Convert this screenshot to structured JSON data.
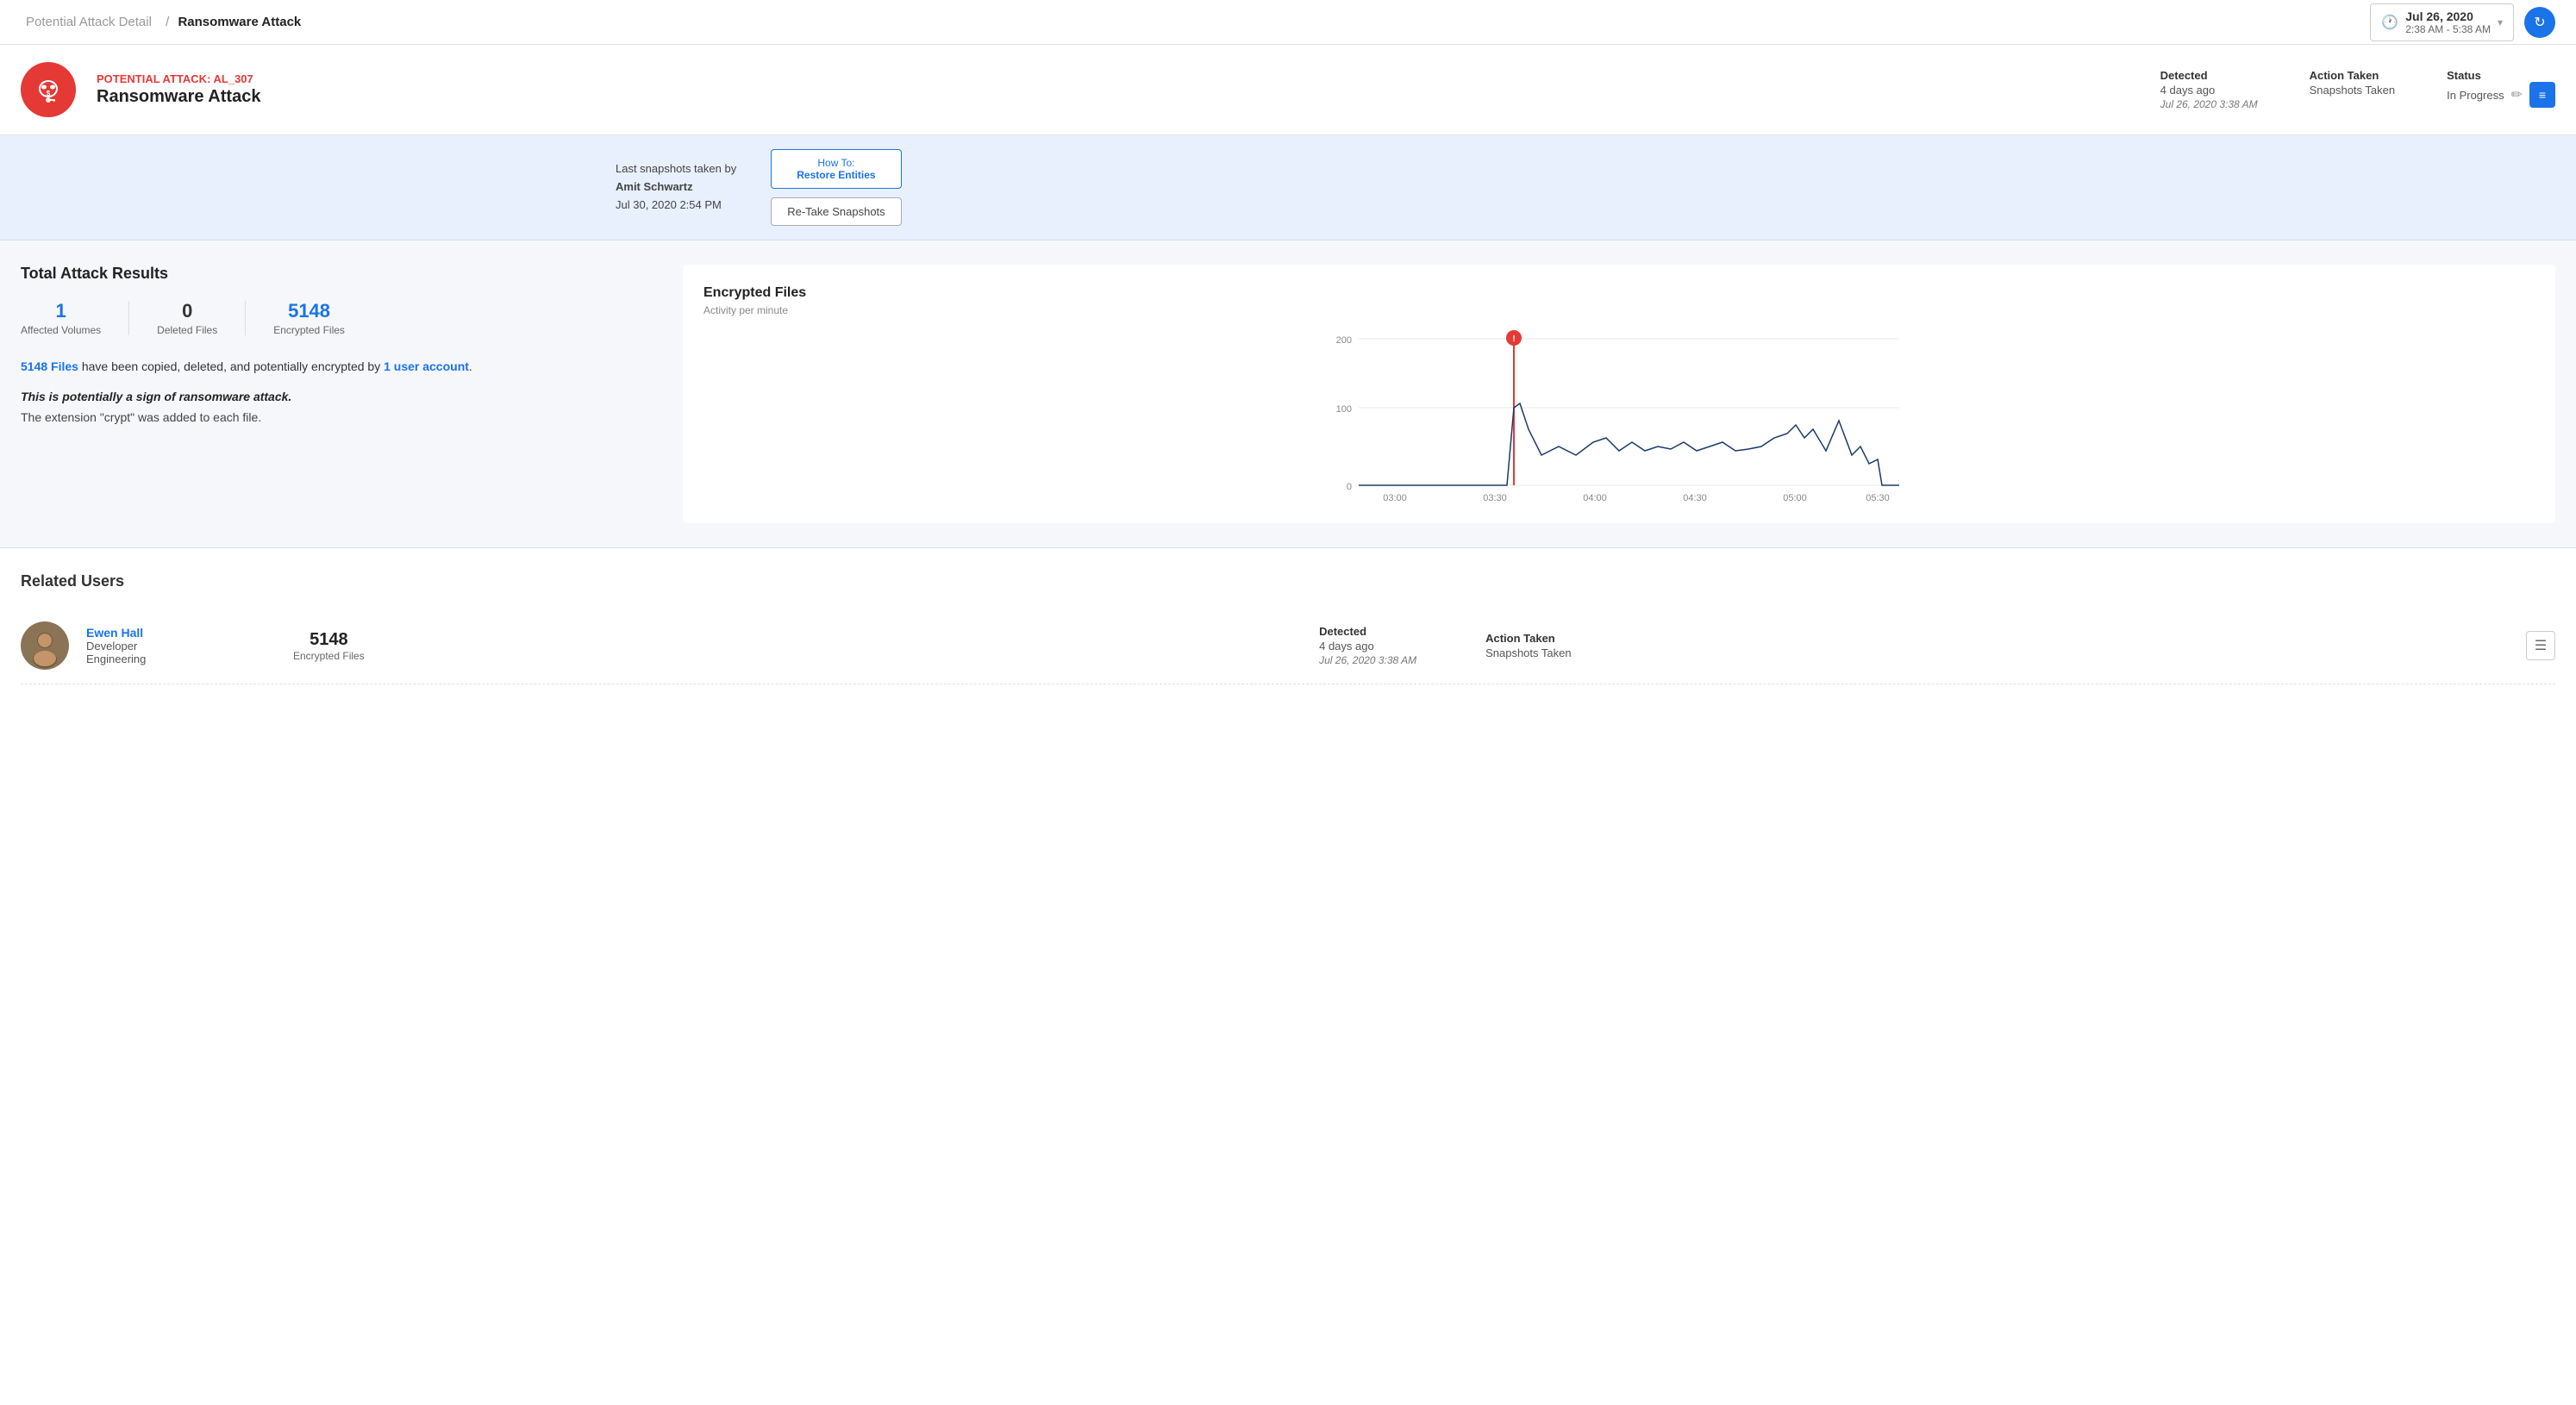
{
  "breadcrumb": {
    "parent": "Potential Attack Detail",
    "separator": "/",
    "current": "Ransomware Attack"
  },
  "date_range": {
    "date": "Jul 26, 2020",
    "time": "2:38 AM - 5:38 AM"
  },
  "attack": {
    "label": "POTENTIAL ATTACK: AL_307",
    "name": "Ransomware Attack",
    "detected_label": "Detected",
    "detected_ago": "4 days ago",
    "detected_date": "Jul 26, 2020 3:38 AM",
    "action_label": "Action Taken",
    "action_value": "Snapshots Taken",
    "status_label": "Status",
    "status_value": "In Progress"
  },
  "snapshot_banner": {
    "last_taken_by": "Last snapshots taken by",
    "user": "Amit Schwartz",
    "date": "Jul 30, 2020 2:54 PM",
    "how_to_label": "How To:",
    "how_to_action": "Restore Entities",
    "retake_label": "Re-Take Snapshots"
  },
  "stats": {
    "title": "Total Attack Results",
    "affected_volumes": "1",
    "affected_label": "Affected Volumes",
    "deleted_files": "0",
    "deleted_label": "Deleted Files",
    "encrypted_files": "5148",
    "encrypted_label": "Encrypted Files"
  },
  "description": {
    "files_count": "5148 Files",
    "desc1": " have been copied, deleted, and potentially encrypted by ",
    "user_link": "1 user account",
    "desc2": ".",
    "warning": "This is potentially a sign of ransomware attack.",
    "note": "The extension \"crypt\" was added to each file."
  },
  "chart": {
    "title": "Encrypted Files",
    "subtitle": "Activity per minute",
    "y_labels": [
      "200",
      "100",
      "0"
    ],
    "x_labels": [
      "03:00",
      "03:30",
      "04:00",
      "04:30",
      "05:00",
      "05:30"
    ]
  },
  "related_users": {
    "title": "Related Users",
    "users": [
      {
        "name": "Ewen Hall",
        "role": "Developer",
        "department": "Engineering",
        "encrypted_count": "5148",
        "encrypted_label": "Encrypted Files",
        "detected_label": "Detected",
        "detected_ago": "4 days ago",
        "detected_date": "Jul 26, 2020 3:38 AM",
        "action_label": "Action Taken",
        "action_value": "Snapshots Taken"
      }
    ]
  },
  "icons": {
    "clock": "🕐",
    "chevron_down": "▾",
    "refresh": "↻",
    "edit": "✏",
    "notes": "📋",
    "notes_icon": "≡"
  }
}
